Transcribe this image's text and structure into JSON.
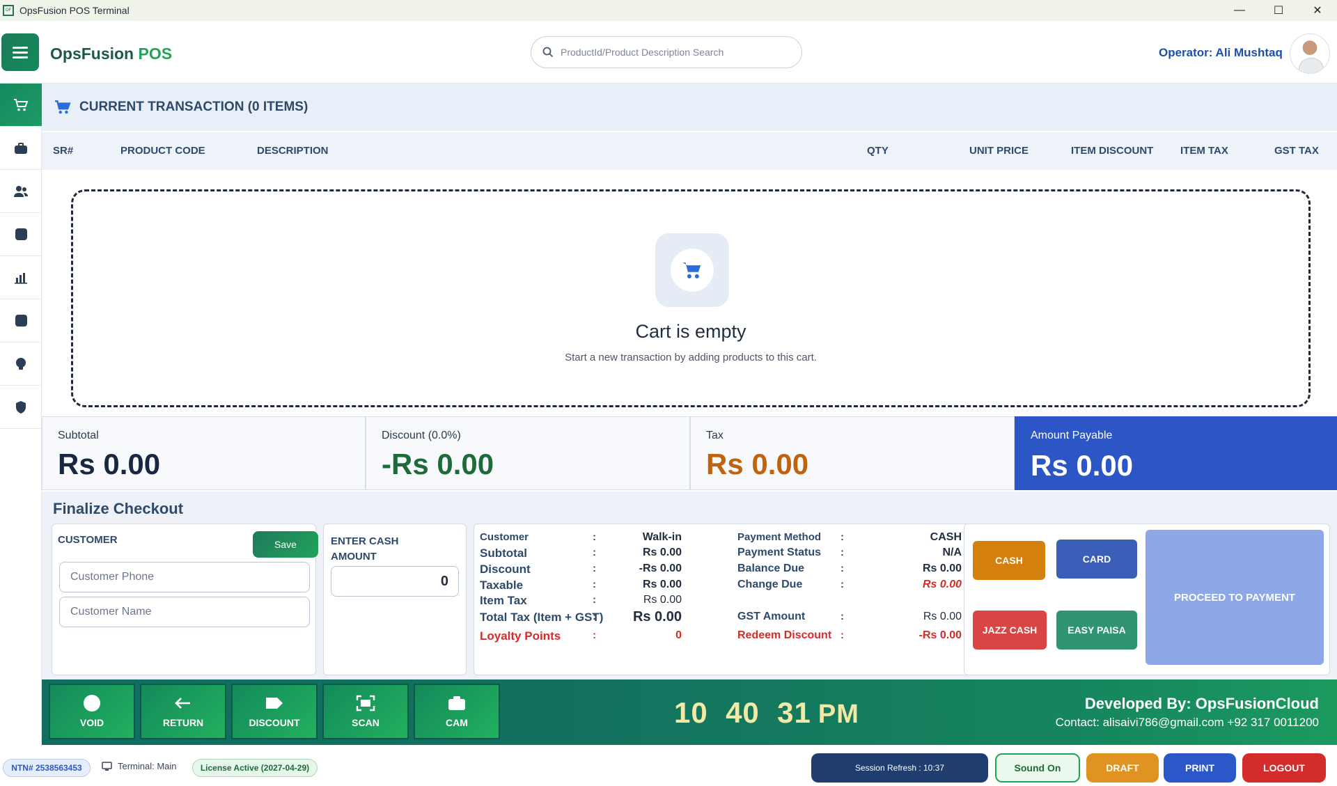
{
  "window": {
    "title": "OpsFusion POS Terminal",
    "minimize": "—",
    "maximize": "☐",
    "close": "✕"
  },
  "header": {
    "brand_main": "OpsFusion",
    "brand_accent": "POS",
    "search_placeholder": "ProductId/Product Description Search",
    "operator": "Operator: Ali Mushtaq"
  },
  "sidebar": {
    "items": [
      "cart-icon",
      "briefcase-icon",
      "users-icon",
      "box-icon",
      "chart-icon",
      "box-icon",
      "bulb-icon",
      "shield-icon"
    ],
    "active": 0
  },
  "transaction": {
    "title": "CURRENT TRANSACTION (0 ITEMS)",
    "columns": [
      "SR#",
      "PRODUCT CODE",
      "DESCRIPTION",
      "QTY",
      "UNIT PRICE",
      "ITEM DISCOUNT",
      "ITEM TAX",
      "GST TAX"
    ],
    "empty_title": "Cart is empty",
    "empty_subtitle": "Start a new transaction by adding products to this cart."
  },
  "totals": {
    "subtotal_label": "Subtotal",
    "subtotal_value": "Rs 0.00",
    "discount_label": "Discount (0.0%)",
    "discount_value": "-Rs 0.00",
    "tax_label": "Tax",
    "tax_value": "Rs 0.00",
    "payable_label": "Amount Payable",
    "payable_value": "Rs 0.00"
  },
  "checkout": {
    "title": "Finalize Checkout",
    "customer_title": "CUSTOMER",
    "save_label": "Save",
    "phone_placeholder": "Customer Phone",
    "name_placeholder": "Customer Name",
    "cash_title_1": "ENTER CASH",
    "cash_title_2": "AMOUNT",
    "cash_value": "0",
    "summary_left": [
      {
        "label": "Customer",
        "value": "Walk-in"
      },
      {
        "label": "Subtotal",
        "value": "Rs 0.00"
      },
      {
        "label": "Discount",
        "value": "-Rs 0.00"
      },
      {
        "label": "Taxable",
        "value": "Rs 0.00"
      },
      {
        "label": "Item Tax",
        "value": "Rs 0.00"
      },
      {
        "label": "Total Tax (Item + GST)",
        "value": "Rs 0.00"
      },
      {
        "label": "Loyalty Points",
        "value": "0"
      }
    ],
    "summary_right": [
      {
        "label": "Payment Method",
        "value": "CASH"
      },
      {
        "label": "Payment Status",
        "value": "N/A"
      },
      {
        "label": "Balance Due",
        "value": "Rs 0.00"
      },
      {
        "label": "Change Due",
        "value": "Rs 0.00"
      },
      {
        "label": "GST Amount",
        "value": "Rs 0.00"
      },
      {
        "label": "Redeem Discount",
        "value": "-Rs 0.00"
      }
    ],
    "colon": ":",
    "payment_buttons": [
      "CASH",
      "CARD",
      "JAZZ CASH",
      "EASY PAISA"
    ],
    "proceed_label": "PROCEED TO PAYMENT"
  },
  "actions": {
    "buttons": [
      "VOID",
      "RETURN",
      "DISCOUNT",
      "SCAN",
      "CAM"
    ],
    "clock_h": "10",
    "clock_m": "40",
    "clock_s": "31",
    "clock_ampm": "PM",
    "developer": "Developed By: OpsFusionCloud",
    "contact": "Contact: alisaivi786@gmail.com  +92 317 0011200"
  },
  "statusbar": {
    "ntn": "NTN# 2538563453",
    "terminal": "Terminal: Main",
    "license": "License Active (2027-04-29)",
    "session": "Session Refresh : 10:37",
    "sound": "Sound On",
    "draft": "DRAFT",
    "print": "PRINT",
    "logout": "LOGOUT"
  },
  "colors": {
    "brand_green": "#1c5a45",
    "accent_green": "#22a35a",
    "payable_blue": "#2c56c6",
    "discount_green": "#1e6b3a",
    "tax_orange": "#c0630f",
    "cash_orange": "#d4800f",
    "card_blue": "#3b5fb8",
    "jazz_red": "#d94545",
    "easypaisa_teal": "#2e9474",
    "logout_red": "#d42b2b",
    "print_blue": "#2b57c9",
    "draft_orange": "#e09320"
  }
}
